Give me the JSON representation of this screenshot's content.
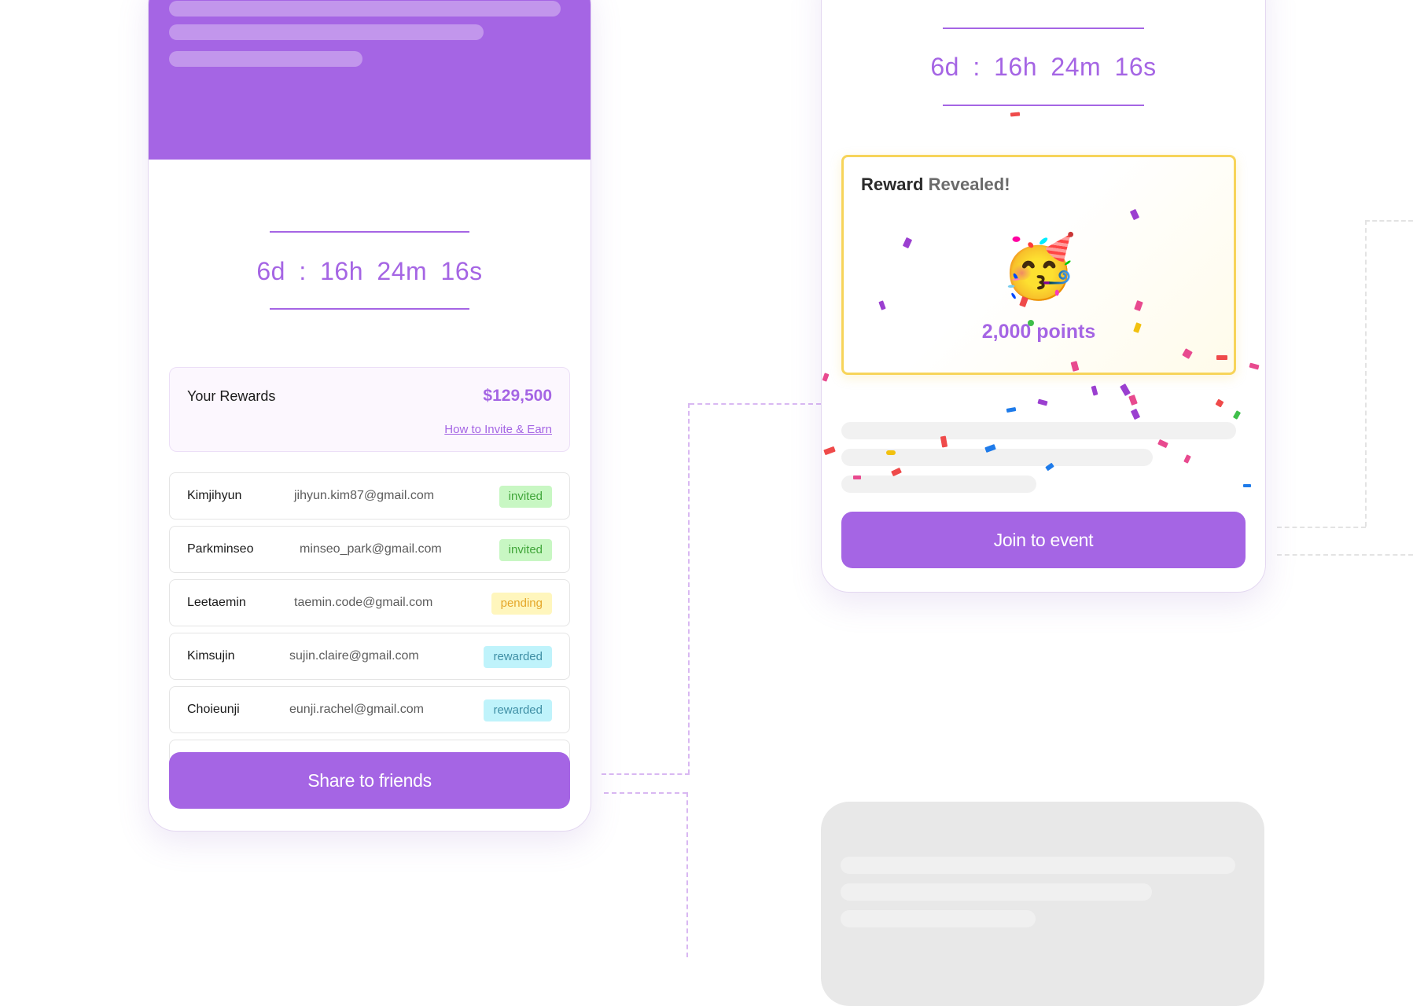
{
  "left_card": {
    "countdown": "6d : 16h  24m  16s",
    "rewards": {
      "label": "Your Rewards",
      "value": "$129,500",
      "link": "How to Invite & Earn"
    },
    "invites": [
      {
        "name": "Kimjihyun",
        "email": "jihyun.kim87@gmail.com",
        "status": "invited"
      },
      {
        "name": "Parkminseo",
        "email": "minseo_park@gmail.com",
        "status": "invited"
      },
      {
        "name": "Leetaemin",
        "email": "taemin.code@gmail.com",
        "status": "pending"
      },
      {
        "name": "Kimsujin",
        "email": "sujin.claire@gmail.com",
        "status": "rewarded"
      },
      {
        "name": "Choieunji",
        "email": "eunji.rachel@gmail.com",
        "status": "rewarded"
      }
    ],
    "share_button": "Share to friends"
  },
  "right_card": {
    "countdown": "6d : 16h  24m  16s",
    "reveal": {
      "title_strong": "Reward",
      "title_soft": "Revealed!",
      "emoji": "🥳",
      "points": "2,000 points"
    },
    "join_button": "Join to event"
  },
  "colors": {
    "brand": "#a565e4",
    "invited_bg": "#c8f7c3",
    "pending_bg": "#fff6bd",
    "rewarded_bg": "#bff3fb",
    "reveal_border": "#f7d45a"
  }
}
